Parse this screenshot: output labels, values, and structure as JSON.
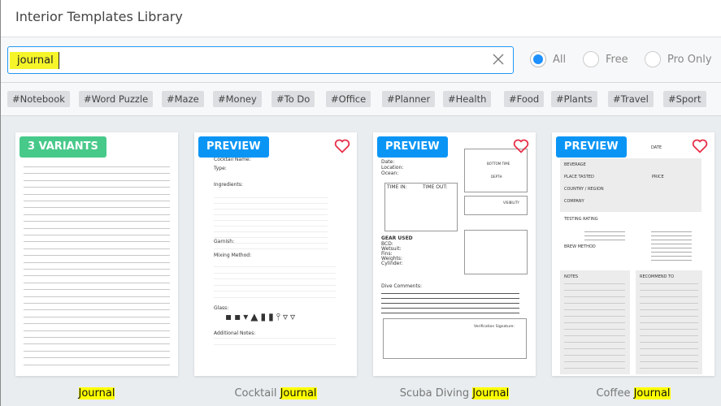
{
  "window": {
    "title": "Interior Templates Library"
  },
  "search": {
    "value": "journal",
    "clear_icon": "close-icon"
  },
  "filters": [
    {
      "label": "All",
      "selected": true
    },
    {
      "label": "Free",
      "selected": false
    },
    {
      "label": "Pro Only",
      "selected": false
    }
  ],
  "tags": [
    "#Notebook",
    "#Word Puzzle",
    "#Maze",
    "#Money",
    "#To Do",
    "#Office",
    "#Planner",
    "#Health",
    "#Food",
    "#Plants",
    "#Travel",
    "#Sport"
  ],
  "colors": {
    "accent": "#0a95f5",
    "variants_badge": "#47c98a",
    "heart": "#e8304a",
    "highlight": "#ffff00"
  },
  "templates": [
    {
      "badge": "3 VARIANTS",
      "caption_prefix": "",
      "caption_match": "Journal",
      "favorite_icon": false
    },
    {
      "badge": "PREVIEW",
      "caption_prefix": "Cocktail ",
      "caption_match": "Journal",
      "favorite_icon": true,
      "thumb": [
        "Cocktail Name:",
        "Type:",
        "Ingredients:",
        "Garnish:",
        "Mixing Method:",
        "Glass:",
        "Additional Notes:"
      ]
    },
    {
      "badge": "PREVIEW",
      "caption_prefix": "Scuba Diving ",
      "caption_match": "Journal",
      "favorite_icon": true,
      "thumb": [
        "Date:",
        "Location:",
        "Ocean:",
        "TIME IN:",
        "TIME OUT:",
        "GEAR USED",
        "BCD:",
        "Wetsuit:",
        "Fins:",
        "Weights:",
        "Cylinder:",
        "Dive Comments:",
        "BOTTOM TIME",
        "DEPTH",
        "VISIBILITY",
        "Verification Signature:"
      ]
    },
    {
      "badge": "PREVIEW",
      "caption_prefix": "Coffee ",
      "caption_match": "Journal",
      "favorite_icon": true,
      "thumb": [
        "DATE",
        "BEVERAGE",
        "PLACE TASTED",
        "PRICE",
        "COUNTRY / REGION",
        "COMPANY",
        "TESTING RATING",
        "BREW METHOD",
        "NOTES",
        "RECOMMEND TO"
      ]
    }
  ]
}
